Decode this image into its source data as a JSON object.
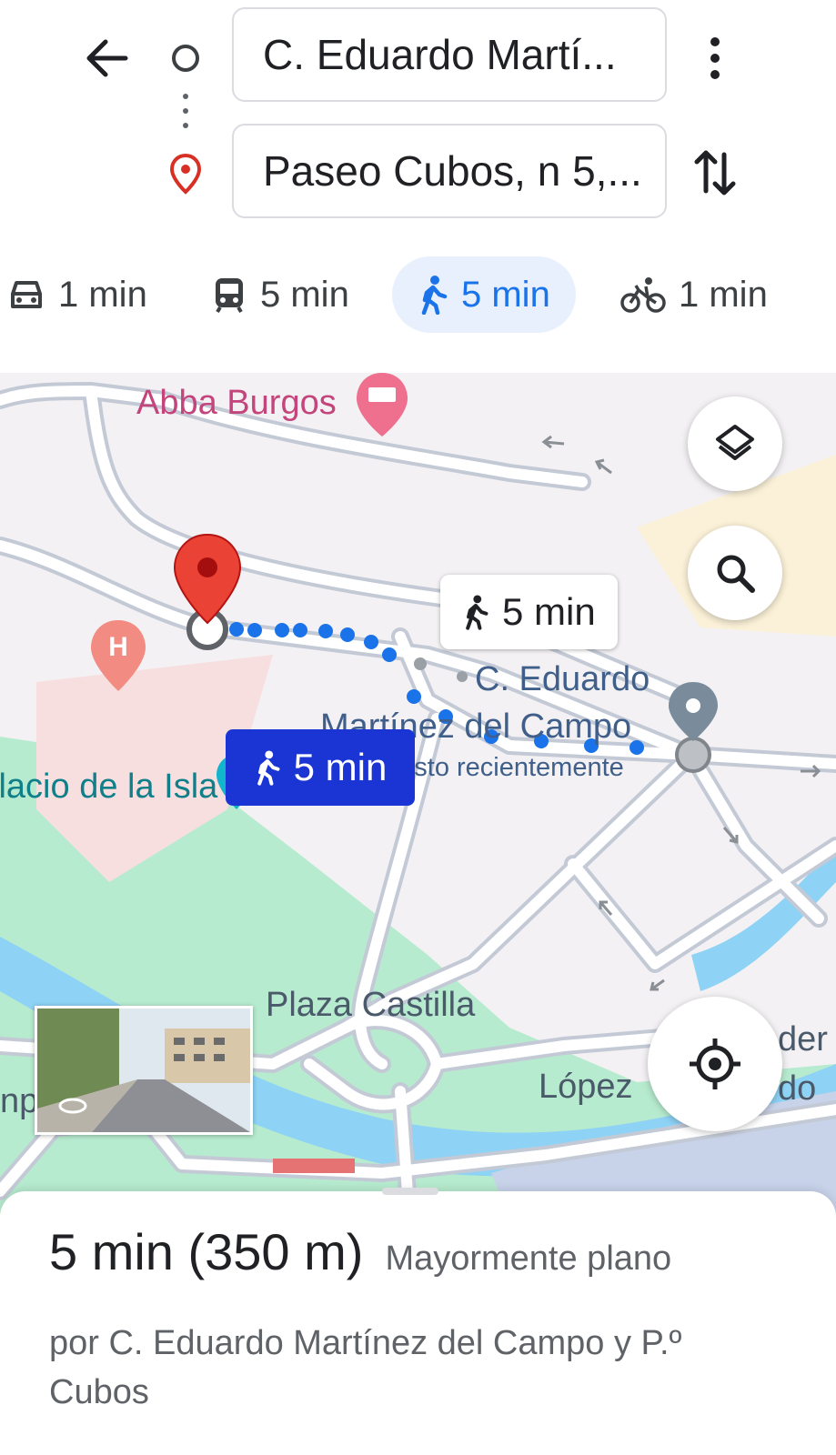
{
  "route": {
    "origin": "C. Eduardo Martí...",
    "destination": "Paseo Cubos, n 5,..."
  },
  "modes": [
    {
      "name": "car-icon",
      "label": "1 min"
    },
    {
      "name": "transit-icon",
      "label": "5 min"
    },
    {
      "name": "walk-icon",
      "label": "5 min",
      "active": true
    },
    {
      "name": "bike-icon",
      "label": "1 min"
    }
  ],
  "map": {
    "labels": {
      "hotel": "Abba Burgos",
      "walk_callout": "5 min",
      "walk_selected": "5 min",
      "street_line1": "C. Eduardo",
      "street_line2": "Martínez del Campo",
      "visto": "Visto recientemente",
      "palacio": "Palacio de la Isla",
      "plaza": "Plaza Castilla",
      "lopez": "López",
      "edge_right_1": "der",
      "edge_right_2": "do",
      "edge_left": "np"
    },
    "colors": {
      "route": "#1a73e8",
      "selected_chip": "#1a35d4",
      "water": "#8ed2f5",
      "park": "#b7ebcf",
      "pin": "#ea4335"
    }
  },
  "summary": {
    "time_distance": "5 min (350 m)",
    "terrain": "Mayormente plano",
    "via": "por C. Eduardo Martínez del Campo y P.º Cubos"
  }
}
